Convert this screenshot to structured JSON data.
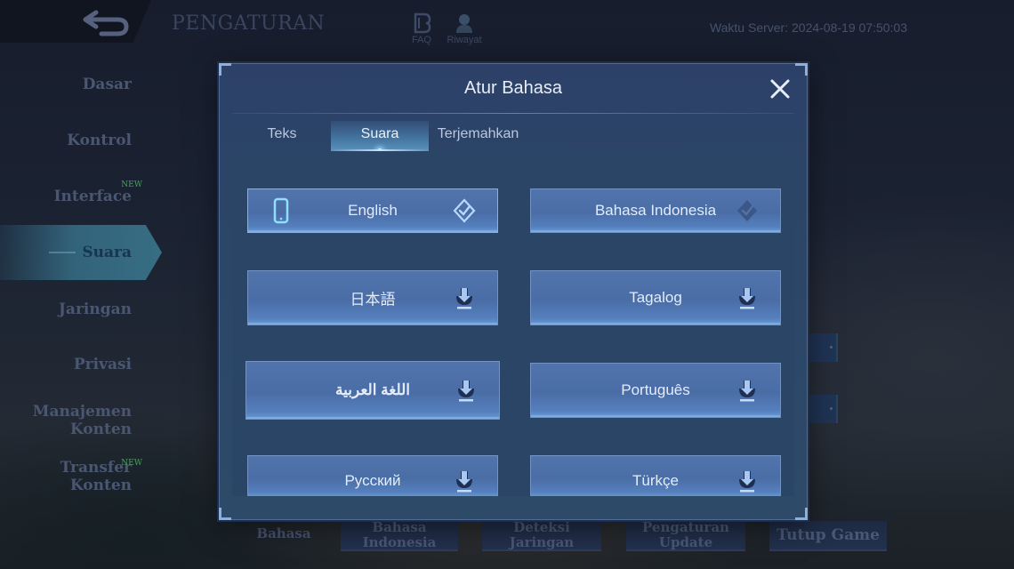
{
  "header": {
    "back_icon": "back-arrow-icon",
    "title": "PENGATURAN",
    "faq_label": "FAQ",
    "history_label": "Riwayat",
    "server_time": "Waktu Server: 2024-08-19 07:50:03"
  },
  "sidebar": {
    "items": [
      {
        "label": "Dasar"
      },
      {
        "label": "Kontrol"
      },
      {
        "label": "Interface",
        "badge": "NEW"
      },
      {
        "label": "Suara",
        "active": true
      },
      {
        "label": "Jaringan"
      },
      {
        "label": "Privasi"
      },
      {
        "label_line1": "Manajemen",
        "label_line2": "Konten"
      },
      {
        "label_line1": "Transfer",
        "label_line2": "Konten",
        "badge": "NEW"
      }
    ]
  },
  "bottom_bar": {
    "language_label": "Bahasa",
    "language_value_line1": "Bahasa",
    "language_value_line2": "Indonesia",
    "network_detect": "Deteksi Jaringan",
    "update_settings_line1": "Pengaturan",
    "update_settings_line2": "Update",
    "close_game": "Tutup Game"
  },
  "dialog": {
    "title": "Atur Bahasa",
    "close_icon": "close-x-icon",
    "tabs": [
      {
        "label": "Teks",
        "active": false
      },
      {
        "label": "Suara",
        "active": true
      },
      {
        "label": "Terjemahkan",
        "active": false
      }
    ],
    "languages": [
      {
        "label": "English",
        "status": "selected",
        "left_icon": "phone-icon",
        "right_icon": "check-diamond-icon"
      },
      {
        "label": "Bahasa Indonesia",
        "status": "available",
        "right_icon": "check-diamond-dim-icon"
      },
      {
        "label": "日本語",
        "status": "download",
        "right_icon": "download-icon"
      },
      {
        "label": "Tagalog",
        "status": "download",
        "right_icon": "download-icon"
      },
      {
        "label": "اللغة العربية",
        "status": "download",
        "right_icon": "download-icon"
      },
      {
        "label": "Português",
        "status": "download",
        "right_icon": "download-icon"
      },
      {
        "label": "Русский",
        "status": "download",
        "right_icon": "download-icon"
      },
      {
        "label": "Türkçe",
        "status": "download",
        "right_icon": "download-icon"
      }
    ]
  },
  "colors": {
    "dialog_bg": "#2c4567",
    "button_bg": "#4a6da6",
    "active_tab": "#3a768c",
    "new_badge": "#4f9e63"
  }
}
